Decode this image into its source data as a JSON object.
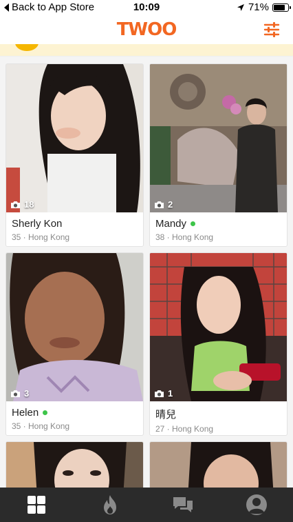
{
  "status_bar": {
    "back_label": "Back to App Store",
    "time": "10:09",
    "battery_text": "71%",
    "battery_level": 0.71
  },
  "header": {
    "logo": "TWOO",
    "brand_color": "#f26722",
    "filter_icon": "sliders-icon"
  },
  "profiles": [
    {
      "name": "Sherly Kon",
      "age": "35",
      "city": "Hong Kong",
      "photos": "18",
      "online": false,
      "meta": "35 · Hong Kong"
    },
    {
      "name": "Mandy",
      "age": "38",
      "city": "Hong Kong",
      "photos": "2",
      "online": true,
      "meta": "38 · Hong Kong"
    },
    {
      "name": "Helen",
      "age": "35",
      "city": "Hong Kong",
      "photos": "3",
      "online": true,
      "meta": "35 · Hong Kong"
    },
    {
      "name": "晴兒",
      "age": "27",
      "city": "Hong Kong",
      "photos": "1",
      "online": false,
      "meta": "27 · Hong Kong"
    }
  ],
  "nav": {
    "items": [
      {
        "icon": "grid-icon",
        "active": true
      },
      {
        "icon": "flame-icon",
        "active": false
      },
      {
        "icon": "chat-icon",
        "active": false
      },
      {
        "icon": "profile-icon",
        "active": false
      }
    ]
  },
  "colors": {
    "online": "#3ec54a",
    "nav_bg": "#2b2b2b",
    "nav_active": "#ffffff",
    "nav_inactive": "#8a8a8a"
  }
}
